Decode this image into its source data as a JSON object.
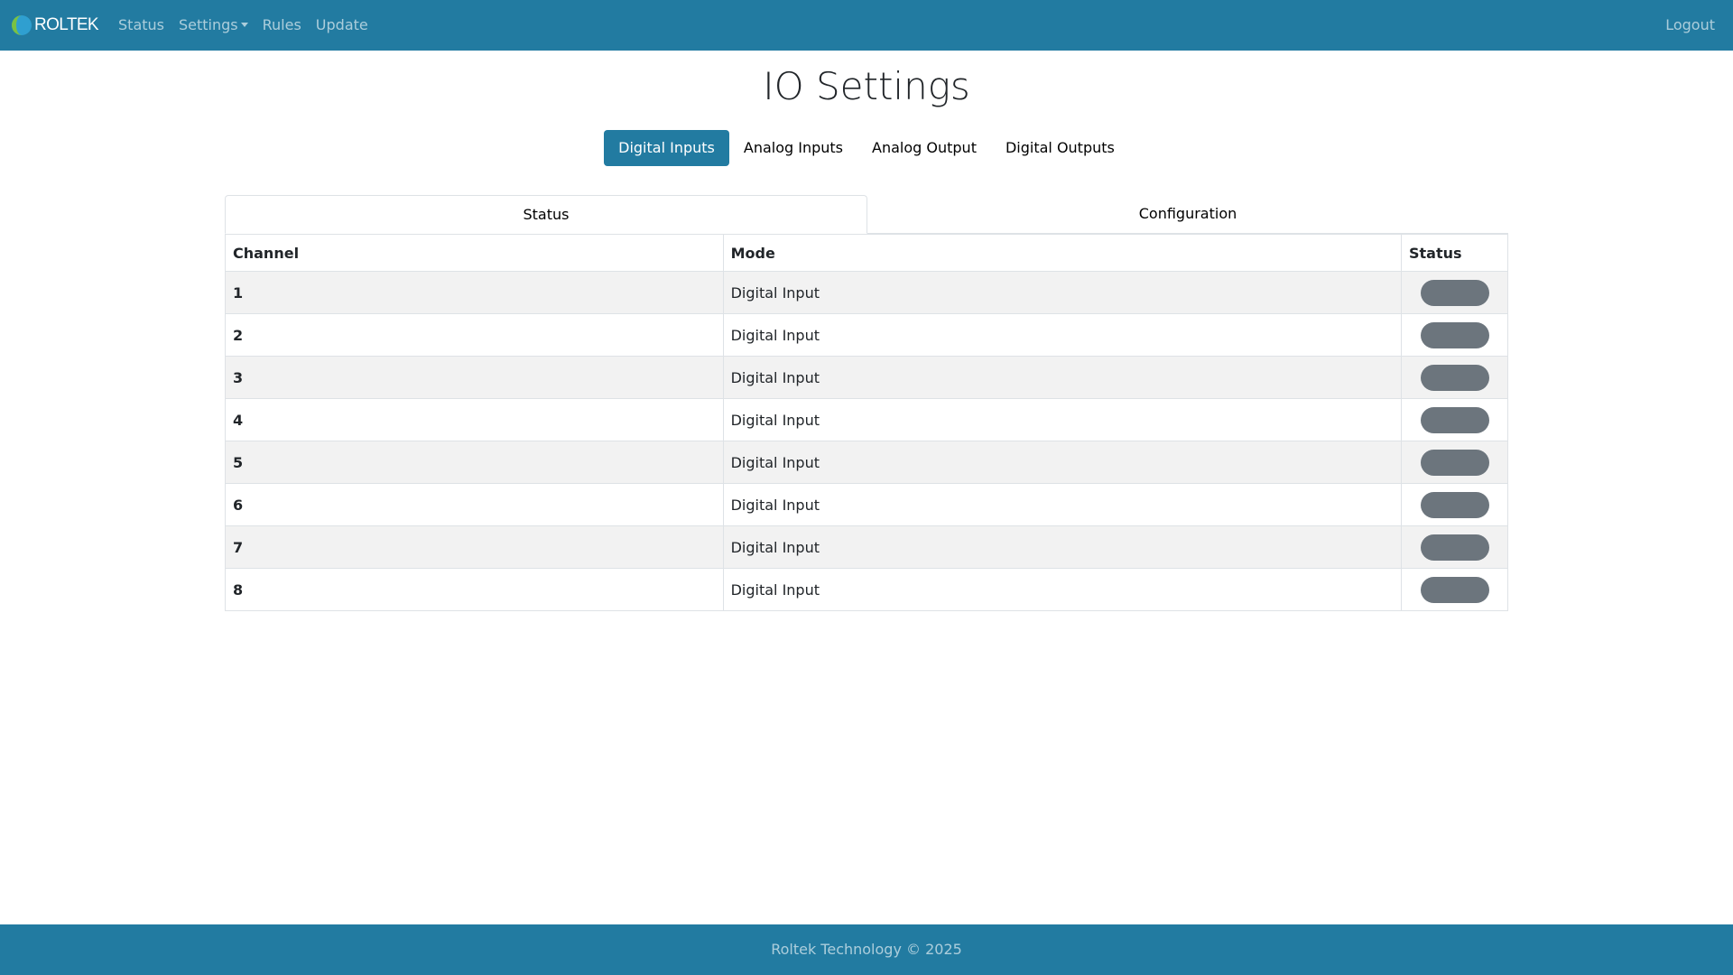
{
  "navbar": {
    "brand": "ROLTEK",
    "links": [
      {
        "label": "Status"
      },
      {
        "label": "Settings"
      },
      {
        "label": "Rules"
      },
      {
        "label": "Update"
      }
    ],
    "logout": "Logout"
  },
  "page": {
    "title": "IO Settings"
  },
  "pills": [
    {
      "label": "Digital Inputs",
      "active": true
    },
    {
      "label": "Analog Inputs",
      "active": false
    },
    {
      "label": "Analog Output",
      "active": false
    },
    {
      "label": "Digital Outputs",
      "active": false
    }
  ],
  "tabs": [
    {
      "label": "Status",
      "active": true
    },
    {
      "label": "Configuration",
      "active": false
    }
  ],
  "table": {
    "headers": [
      "Channel",
      "Mode",
      "Status"
    ],
    "rows": [
      {
        "channel": "1",
        "mode": "Digital Input"
      },
      {
        "channel": "2",
        "mode": "Digital Input"
      },
      {
        "channel": "3",
        "mode": "Digital Input"
      },
      {
        "channel": "4",
        "mode": "Digital Input"
      },
      {
        "channel": "5",
        "mode": "Digital Input"
      },
      {
        "channel": "6",
        "mode": "Digital Input"
      },
      {
        "channel": "7",
        "mode": "Digital Input"
      },
      {
        "channel": "8",
        "mode": "Digital Input"
      }
    ]
  },
  "footer": {
    "text": "Roltek Technology © 2025"
  },
  "colors": {
    "primary": "#227ba1",
    "status_off": "#6c757d"
  }
}
